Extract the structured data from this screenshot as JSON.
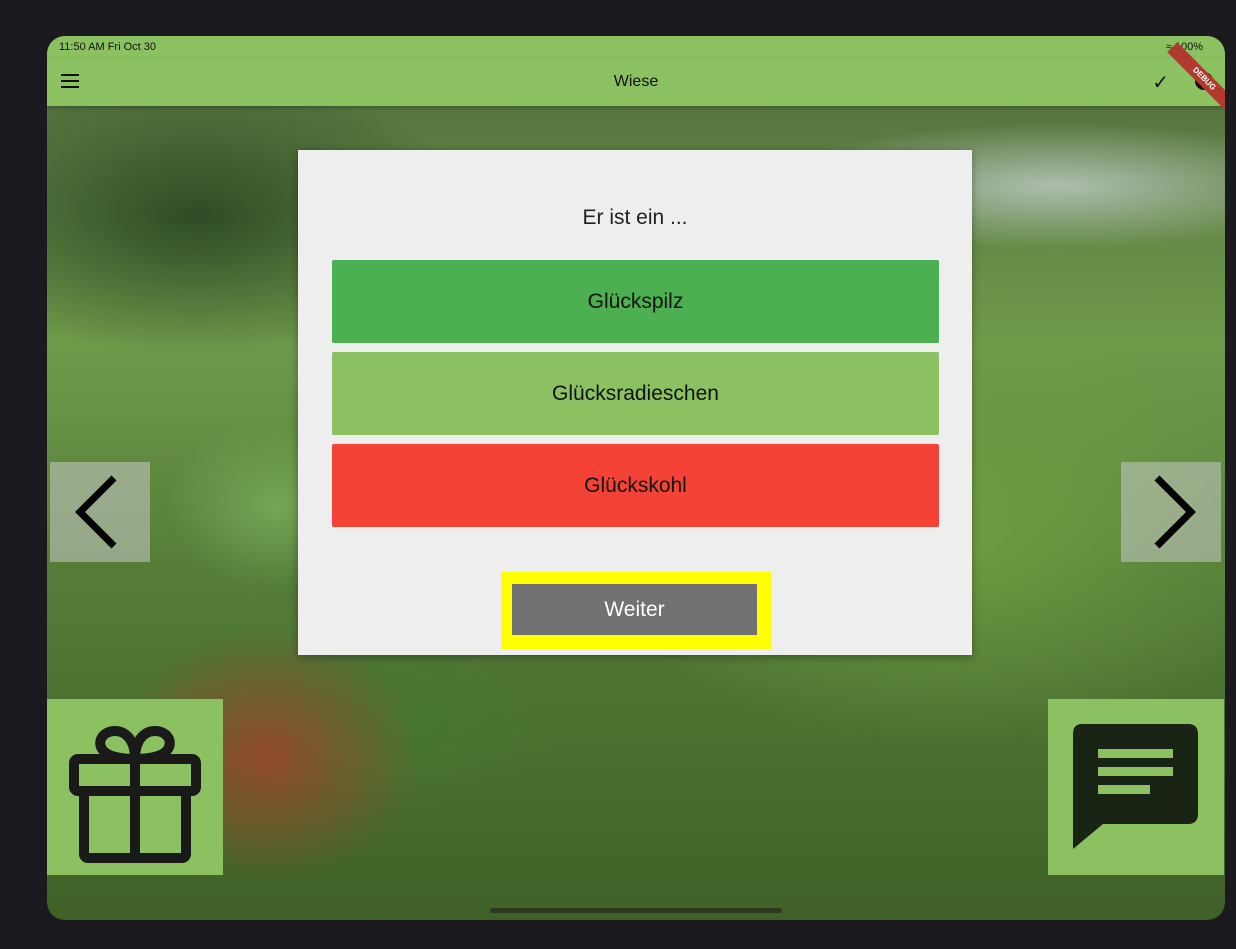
{
  "status_bar": {
    "time_date": "11:50 AM  Fri Oct 30",
    "battery": "100%"
  },
  "app_bar": {
    "title": "Wiese",
    "debug_banner": "DEBUG"
  },
  "quiz": {
    "question": "Er ist ein ...",
    "answers": [
      {
        "label": "Glückspilz",
        "color": "#4caf50"
      },
      {
        "label": "Glücksradieschen",
        "color": "#8bc160"
      },
      {
        "label": "Glückskohl",
        "color": "#f44336"
      }
    ],
    "continue_label": "Weiter",
    "highlight_color": "#ffff00"
  },
  "icons": {
    "menu": "menu-icon",
    "check": "check-icon",
    "info": "info-icon",
    "prev": "chevron-left-icon",
    "next": "chevron-right-icon",
    "gift": "gift-icon",
    "chat": "chat-icon"
  },
  "colors": {
    "accent": "#8bc160",
    "card": "#eeeeee",
    "button_gray": "#727272"
  }
}
